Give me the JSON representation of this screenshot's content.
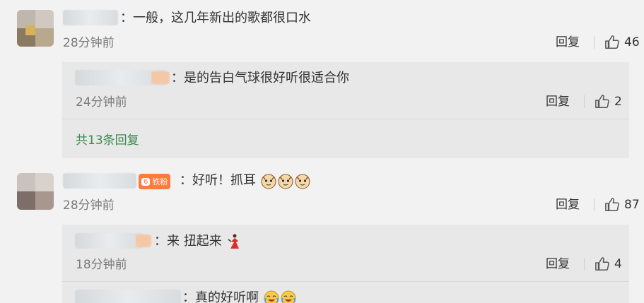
{
  "comments": [
    {
      "text": "：一般，这几年新出的歌都很口水",
      "time": "28分钟前",
      "reply_label": "回复",
      "likes": "46",
      "replies": [
        {
          "text": "：是的告白气球很好听很适合你",
          "time": "24分钟前",
          "reply_label": "回复",
          "likes": "2"
        }
      ],
      "more_label": "共13条回复"
    },
    {
      "badge": "铁粉",
      "badge_level": "6",
      "text": "：好听！抓耳",
      "time": "28分钟前",
      "reply_label": "回复",
      "likes": "87",
      "replies": [
        {
          "text": "：来  扭起来",
          "time": "18分钟前",
          "reply_label": "回复",
          "likes": "4"
        },
        {
          "text": "：真的好听啊"
        }
      ]
    }
  ],
  "icons": {
    "like": "thumbs-up-icon",
    "emoji_cat": "cat-face-emoji",
    "emoji_dancer": "dancer-emoji",
    "emoji_cry": "crying-laughing-emoji"
  },
  "colors": {
    "accent_green": "#3b8a4f",
    "badge_orange": "#ff7a3c",
    "background": "#f2f2f2",
    "reply_bg": "#e8e8e8"
  }
}
